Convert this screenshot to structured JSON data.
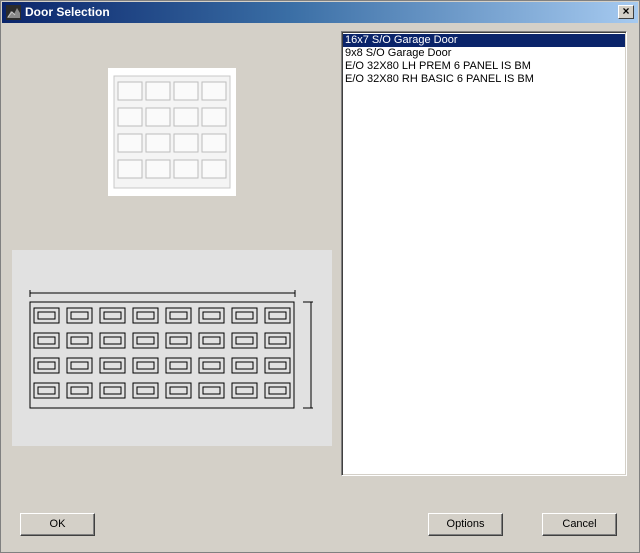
{
  "window": {
    "title": "Door Selection",
    "close_label": "×"
  },
  "icons": {
    "title": "door-app-icon",
    "close": "close-icon"
  },
  "doors": {
    "items": [
      {
        "label": "16x7 S/O Garage Door",
        "selected": true
      },
      {
        "label": "9x8 S/O Garage Door",
        "selected": false
      },
      {
        "label": "E/O 32X80 LH PREM  6 PANEL IS BM",
        "selected": false
      },
      {
        "label": "E/O 32X80 RH BASIC 6 PANEL IS BM",
        "selected": false
      }
    ]
  },
  "buttons": {
    "ok": "OK",
    "options": "Options",
    "cancel": "Cancel"
  },
  "colors": {
    "selection": "#0a246a",
    "face": "#d4d0c8",
    "preview_bg": "#e1e1e1"
  }
}
